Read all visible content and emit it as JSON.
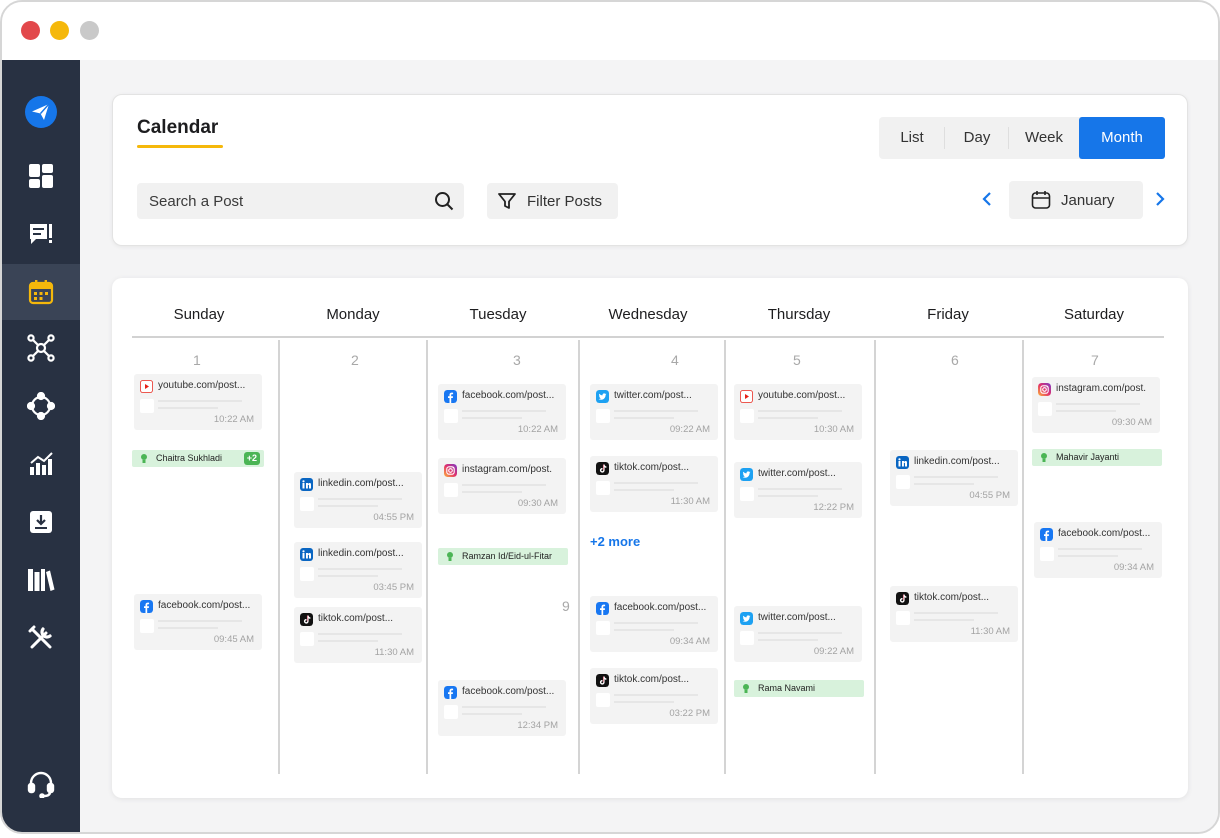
{
  "window": {
    "controls": [
      "close",
      "minimize",
      "zoom"
    ]
  },
  "sidebar": {
    "items": [
      {
        "icon": "paper-plane-logo-icon",
        "active": false
      },
      {
        "icon": "dashboard-grid-icon",
        "active": false
      },
      {
        "icon": "compose-post-icon",
        "active": false
      },
      {
        "icon": "calendar-icon",
        "active": true
      },
      {
        "icon": "network-hub-icon",
        "active": false
      },
      {
        "icon": "connect-nodes-icon",
        "active": false
      },
      {
        "icon": "analytics-chart-icon",
        "active": false
      },
      {
        "icon": "inbox-download-icon",
        "active": false
      },
      {
        "icon": "library-books-icon",
        "active": false
      },
      {
        "icon": "tools-icon",
        "active": false
      },
      {
        "icon": "support-headset-icon",
        "active": false
      }
    ]
  },
  "header": {
    "title": "Calendar",
    "view_tabs": [
      "List",
      "Day",
      "Week",
      "Month"
    ],
    "active_view": "Month",
    "search": {
      "placeholder": "Search a Post"
    },
    "filter_label": "Filter Posts",
    "month": "January"
  },
  "calendar": {
    "days": [
      "Sunday",
      "Monday",
      "Tuesday",
      "Wednesday",
      "Thursday",
      "Friday",
      "Saturday"
    ],
    "date_numbers": [
      "1",
      "2",
      "3",
      "4",
      "5",
      "6",
      "7",
      "9"
    ],
    "more_label": "+2 more",
    "posts": [
      {
        "network": "youtube",
        "text": "youtube.com/post...",
        "time": "10:22 AM"
      },
      {
        "network": "facebook",
        "text": "facebook.com/post...",
        "time": "09:45 AM"
      },
      {
        "network": "linkedin",
        "text": "linkedin.com/post...",
        "time": "04:55 PM"
      },
      {
        "network": "linkedin",
        "text": "linkedin.com/post...",
        "time": "03:45 PM"
      },
      {
        "network": "tiktok",
        "text": "tiktok.com/post...",
        "time": "11:30 AM"
      },
      {
        "network": "facebook",
        "text": "facebook.com/post...",
        "time": "10:22 AM"
      },
      {
        "network": "instagram",
        "text": "instagram.com/post.",
        "time": "09:30 AM"
      },
      {
        "network": "facebook",
        "text": "facebook.com/post...",
        "time": "12:34 PM"
      },
      {
        "network": "twitter",
        "text": "twitter.com/post...",
        "time": "09:22 AM"
      },
      {
        "network": "tiktok",
        "text": "tiktok.com/post...",
        "time": "11:30 AM"
      },
      {
        "network": "facebook",
        "text": "facebook.com/post...",
        "time": "09:34 AM"
      },
      {
        "network": "tiktok",
        "text": "tiktok.com/post...",
        "time": "03:22 PM"
      },
      {
        "network": "youtube",
        "text": "youtube.com/post...",
        "time": "10:30 AM"
      },
      {
        "network": "twitter",
        "text": "twitter.com/post...",
        "time": "12:22 PM"
      },
      {
        "network": "twitter",
        "text": "twitter.com/post...",
        "time": "09:22 AM"
      },
      {
        "network": "linkedin",
        "text": "linkedin.com/post...",
        "time": "04:55 PM"
      },
      {
        "network": "tiktok",
        "text": "tiktok.com/post...",
        "time": "11:30 AM"
      },
      {
        "network": "instagram",
        "text": "instagram.com/post.",
        "time": "09:30 AM"
      },
      {
        "network": "facebook",
        "text": "facebook.com/post...",
        "time": "09:34 AM"
      }
    ],
    "holidays": [
      {
        "name": "Chaitra Sukhladi",
        "badge": "+2"
      },
      {
        "name": "Ramzan Id/Eid-ul-Fitar"
      },
      {
        "name": "Rama Navami"
      },
      {
        "name": "Mahavir Jayanti"
      }
    ]
  },
  "colors": {
    "accent": "#1676e9",
    "sidebar_bg": "#283142",
    "title_underline": "#f5b80b",
    "holiday_bg": "#d8f2dc",
    "badge": "#4bb555",
    "youtube": "#e62117",
    "facebook": "#1877f2",
    "linkedin": "#0a66c2",
    "twitter": "#1da1f2",
    "tiktok": "#111111"
  }
}
